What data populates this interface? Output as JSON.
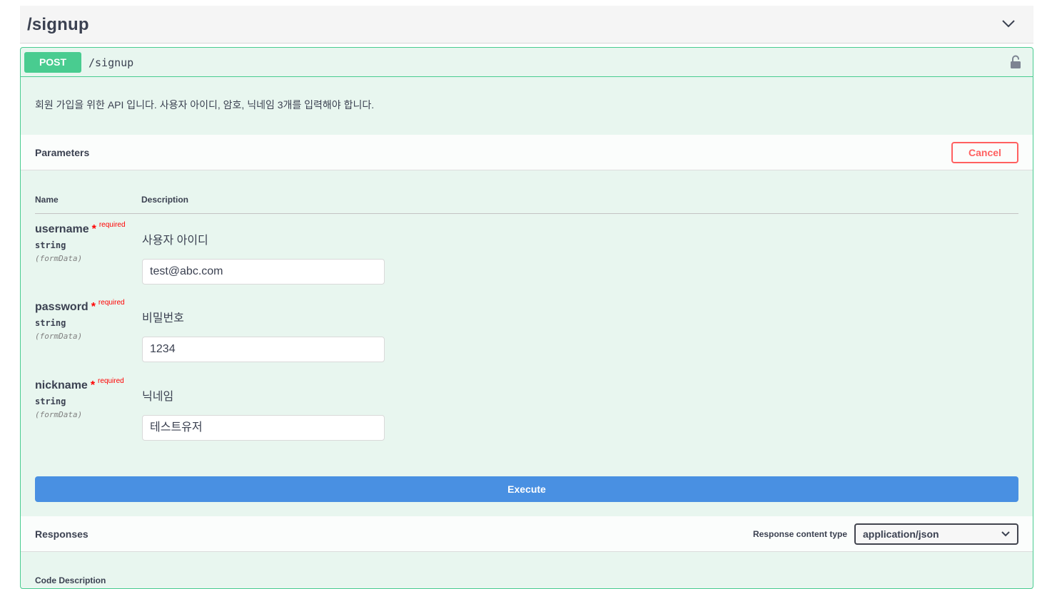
{
  "tag": {
    "title": "/signup",
    "chevron_icon": "chevron-down-icon"
  },
  "operation": {
    "method": "POST",
    "path": "/signup",
    "lock_icon": "lock-open-icon",
    "description": "회원 가입을 위한 API 입니다. 사용자 아이디, 암호, 닉네임 3개를 입력해야 합니다.",
    "colors": {
      "method": "#49cc90",
      "background": "#e8f6ef",
      "execute": "#4990e2",
      "cancel": "#ff6060"
    }
  },
  "parameters": {
    "title": "Parameters",
    "cancel_label": "Cancel",
    "col_name": "Name",
    "col_description": "Description",
    "items": [
      {
        "name": "username",
        "star": "*",
        "required": "required",
        "type": "string",
        "in": "(formData)",
        "description": "사용자 아이디",
        "value": "test@abc.com"
      },
      {
        "name": "password",
        "star": "*",
        "required": "required",
        "type": "string",
        "in": "(formData)",
        "description": "비밀번호",
        "value": "1234"
      },
      {
        "name": "nickname",
        "star": "*",
        "required": "required",
        "type": "string",
        "in": "(formData)",
        "description": "닉네임",
        "value": "테스트유저"
      }
    ]
  },
  "execute_label": "Execute",
  "responses": {
    "title": "Responses",
    "content_type_label": "Response content type",
    "content_type_value": "application/json",
    "cutoff_text": "Code        Description"
  }
}
